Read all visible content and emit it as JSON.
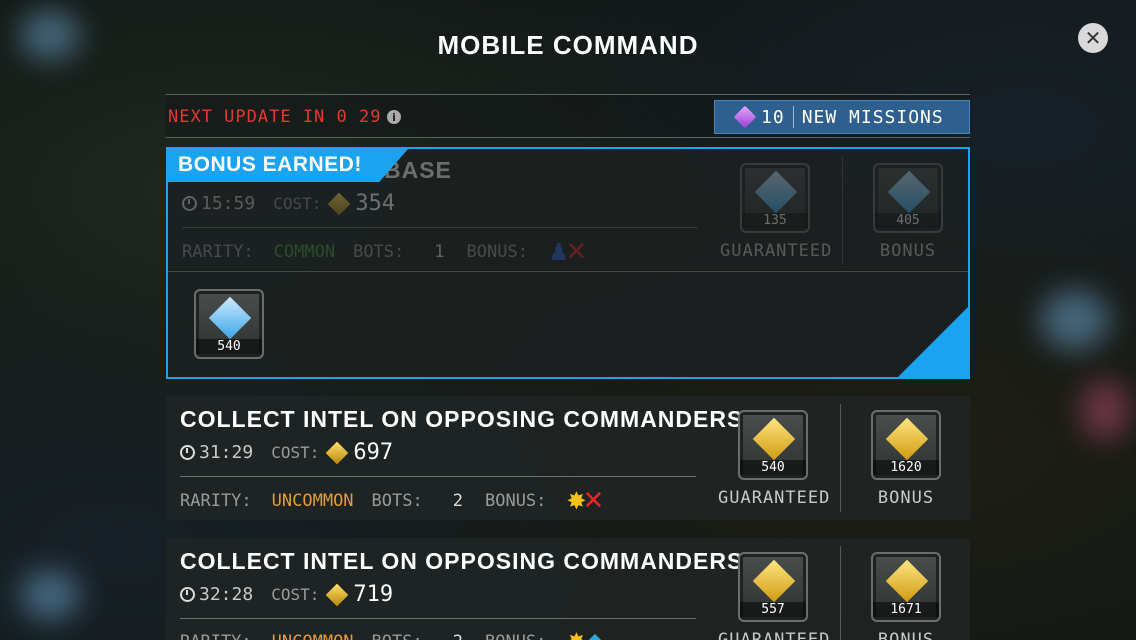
{
  "title": "MOBILE COMMAND",
  "header": {
    "next_update": "NEXT UPDATE IN 0 29",
    "mission_count": "10",
    "missions_label": "NEW MISSIONS"
  },
  "labels": {
    "cost": "COST:",
    "rarity": "RARITY:",
    "bots": "BOTS:",
    "bonus": "BONUS:",
    "guaranteed": "GUARANTEED",
    "bonus_reward": "BONUS"
  },
  "missions": [
    {
      "banner": "BONUS EARNED!",
      "title_tail": "BASE",
      "time": "15:59",
      "cost": "354",
      "rarity": "COMMON",
      "rarity_color": "#3fa33a",
      "bots": "1",
      "guaranteed_qty": "135",
      "bonus_qty": "405",
      "earned_qty": "540"
    },
    {
      "title": "COLLECT INTEL ON OPPOSING COMMANDERS",
      "time": "31:29",
      "cost": "697",
      "rarity": "UNCOMMON",
      "rarity_color": "#e39a3a",
      "bots": "2",
      "guaranteed_qty": "540",
      "bonus_qty": "1620"
    },
    {
      "title": "COLLECT INTEL ON OPPOSING COMMANDERS",
      "time": "32:28",
      "cost": "719",
      "rarity": "UNCOMMON",
      "rarity_color": "#e39a3a",
      "bots": "2",
      "guaranteed_qty": "557",
      "bonus_qty": "1671"
    }
  ],
  "icons": [
    "close-icon",
    "info-icon",
    "cube-icon",
    "clock-icon",
    "gem-icon",
    "bot-icon",
    "burst-icon",
    "shield-icon",
    "x-icon"
  ]
}
